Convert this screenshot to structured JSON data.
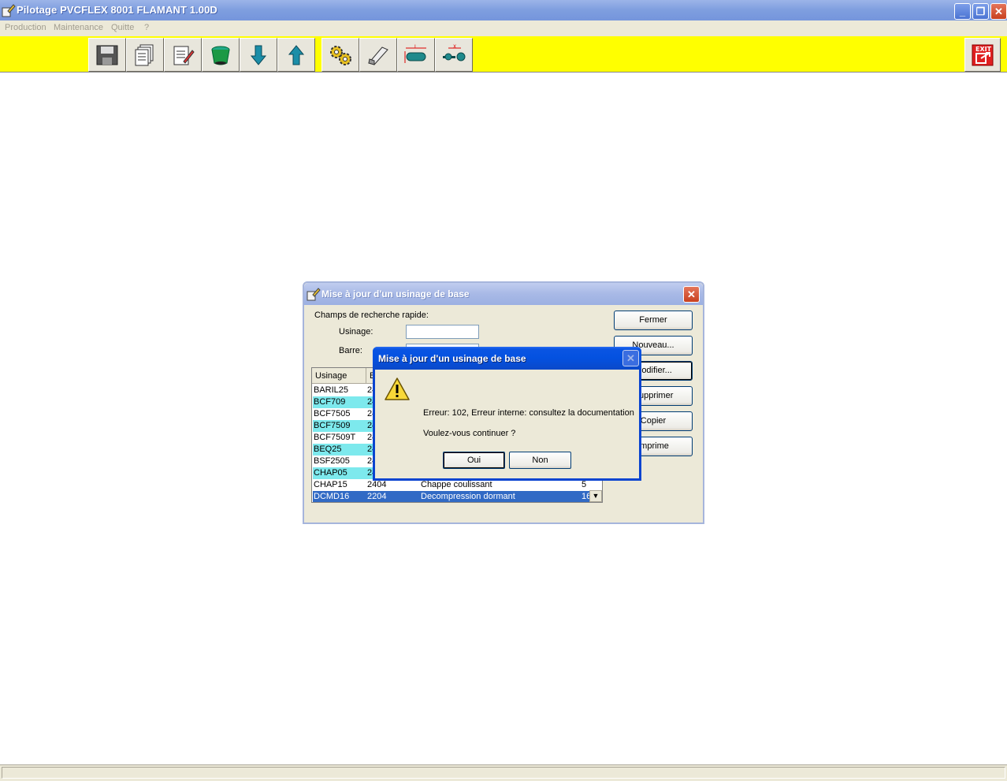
{
  "app": {
    "title": "Pilotage PVCFLEX 8001 FLAMANT 1.00D"
  },
  "menu": [
    "Production",
    "Maintenance",
    "Quitte",
    "?"
  ],
  "toolbar": {
    "buttons": [
      "save-icon",
      "pages-icon",
      "edit-form-icon",
      "bucket-icon",
      "arrow-down-icon",
      "arrow-up-icon",
      "gears-icon",
      "profile-bar-icon",
      "length-measure-icon",
      "gap-measure-icon"
    ],
    "exit_label": "EXIT"
  },
  "dialog": {
    "title": "Mise à jour d'un usinage de base",
    "search_label": "Champs de recherche rapide:",
    "usinage_label": "Usinage:",
    "barre_label": "Barre:",
    "usinage_value": "",
    "barre_value": "",
    "buttons": [
      "Fermer",
      "Nouveau...",
      "Modifier...",
      "Supprimer",
      "Copier",
      "Imprime"
    ],
    "columns": [
      "Usinage",
      "B"
    ],
    "rows": [
      {
        "usinage": "BARIL25",
        "barre": "24",
        "desc": "",
        "qty": ""
      },
      {
        "usinage": "BCF709",
        "barre": "24",
        "desc": "",
        "qty": ""
      },
      {
        "usinage": "BCF7505",
        "barre": "24",
        "desc": "",
        "qty": ""
      },
      {
        "usinage": "BCF7509",
        "barre": "24",
        "desc": "",
        "qty": ""
      },
      {
        "usinage": "BCF7509T",
        "barre": "24",
        "desc": "",
        "qty": ""
      },
      {
        "usinage": "BEQ25",
        "barre": "24",
        "desc": "",
        "qty": ""
      },
      {
        "usinage": "BSF2505",
        "barre": "24",
        "desc": "",
        "qty": ""
      },
      {
        "usinage": "CHAP05",
        "barre": "24",
        "desc": "",
        "qty": ""
      },
      {
        "usinage": "CHAP15",
        "barre": "2404",
        "desc": "Chappe coulissant",
        "qty": "5"
      },
      {
        "usinage": "DCMD16",
        "barre": "2204",
        "desc": "Decompression dormant",
        "qty": "16"
      }
    ]
  },
  "error_dialog": {
    "title": "Mise à jour d'un usinage de base",
    "message": "Erreur: 102, Erreur interne: consultez la documentation",
    "question": "Voulez-vous continuer ?",
    "yes_label": "Oui",
    "no_label": "Non",
    "icon": "warning-icon"
  }
}
